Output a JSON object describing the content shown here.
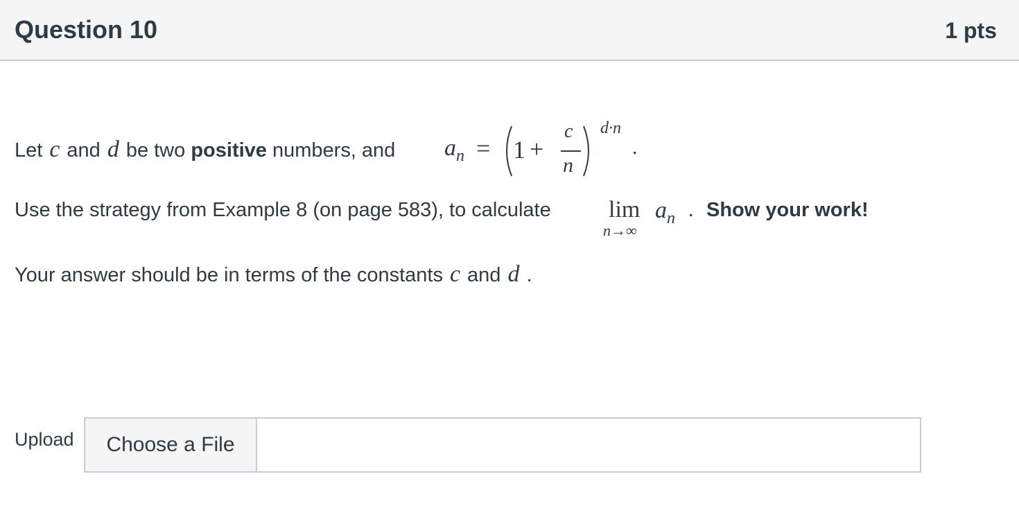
{
  "header": {
    "title": "Question 10",
    "points": "1 pts"
  },
  "question": {
    "line1": {
      "prefix": "Let",
      "var_c": "c",
      "and1": "and",
      "var_d": "d",
      "middle": "be two",
      "bold": "positive",
      "suffix": "numbers, and",
      "formula": {
        "lhs": "a",
        "sub": "n",
        "eq": "=",
        "one": "1",
        "plus": "+",
        "num": "c",
        "den": "n",
        "exp": "d·n",
        "period": "."
      }
    },
    "line2": {
      "text": "Use the strategy from Example 8 (on page 583), to calculate",
      "lim": "lim",
      "lim_sub": "n→∞",
      "a": "a",
      "a_sub": "n",
      "dot": ".",
      "bold": "Show your work!"
    },
    "line3": {
      "text": "Your answer should be in terms of the constants",
      "var_c": "c",
      "and": "and",
      "var_d": "d",
      "period": "."
    }
  },
  "upload": {
    "label": "Upload",
    "button": "Choose a File"
  }
}
